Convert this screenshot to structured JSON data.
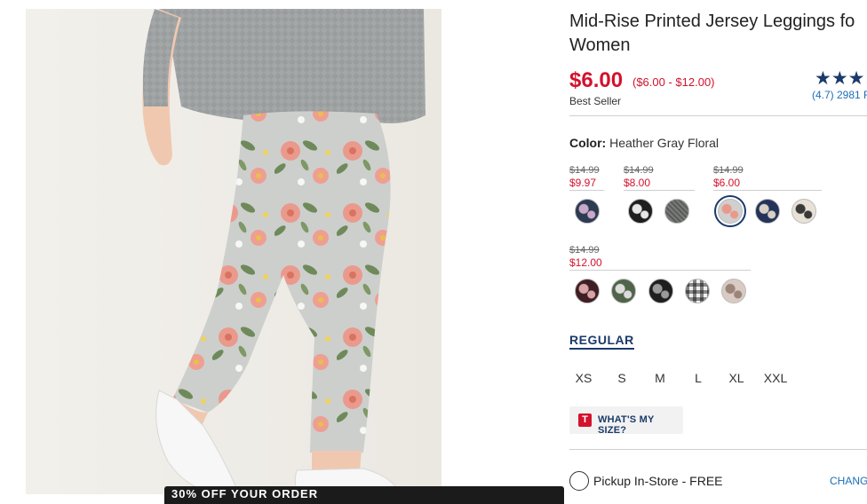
{
  "product": {
    "title_line1": "Mid-Rise Printed Jersey Leggings fo",
    "title_line2": "Women",
    "price": "$6.00",
    "price_range": "($6.00 - $12.00)",
    "badge": "Best Seller",
    "stars": "★★★",
    "rating": 4.7,
    "reviews_text": "(4.7) 2981 R"
  },
  "color": {
    "label": "Color:",
    "value": "Heather Gray Floral"
  },
  "price_groups": [
    {
      "old": "$14.99",
      "new": "$9.97"
    },
    {
      "old": "$14.99",
      "new": "$8.00"
    },
    {
      "old": "$14.99",
      "new": "$6.00"
    },
    {
      "old": "$14.99",
      "new": "$12.00"
    }
  ],
  "swatches": [
    {
      "name": "navy-leaf",
      "color": "#2c3a52",
      "accent": "#c9a9c8"
    },
    {
      "name": "black-floral",
      "color": "#1e1e1e",
      "accent": "#e6e6e6"
    },
    {
      "name": "charcoal-texture",
      "color": "#5a5c5a",
      "accent": "#7a7c7a"
    },
    {
      "name": "heather-gray-floral",
      "color": "#cfd0cf",
      "accent": "#e9998c"
    },
    {
      "name": "navy-floral",
      "color": "#23335a",
      "accent": "#d8d2c4"
    },
    {
      "name": "cream-floral",
      "color": "#e8e2d6",
      "accent": "#3a3a3a"
    },
    {
      "name": "burgundy-floral",
      "color": "#3f1e24",
      "accent": "#d7a5a8"
    },
    {
      "name": "olive-floral",
      "color": "#4f6448",
      "accent": "#dcdcdc"
    },
    {
      "name": "black-print",
      "color": "#1f1f1f",
      "accent": "#9a9a9a"
    },
    {
      "name": "gingham",
      "color": "#f0f0f0",
      "accent": "#2a2a2a"
    },
    {
      "name": "leopard",
      "color": "#d9cbc3",
      "accent": "#9c8478"
    }
  ],
  "fit": {
    "label": "REGULAR"
  },
  "sizes": [
    "XS",
    "S",
    "M",
    "L",
    "XL",
    "XXL"
  ],
  "size_help": {
    "icon": "T",
    "label": "WHAT'S MY SIZE?"
  },
  "pickup": {
    "label": "Pickup In-Store - FREE",
    "change": "CHANGE"
  },
  "promo": {
    "text": "30% OFF YOUR ORDER"
  },
  "colors": {
    "price_red": "#d4122c",
    "navy": "#1a3a6b",
    "link_blue": "#1a6fb7"
  }
}
